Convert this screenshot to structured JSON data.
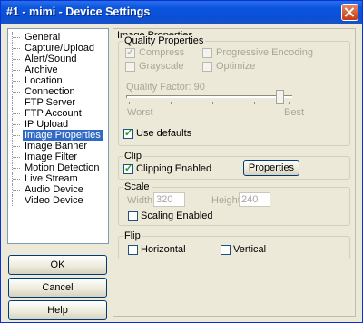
{
  "window": {
    "title": "#1 - mimi - Device Settings"
  },
  "tree": {
    "items": [
      "General",
      "Capture/Upload",
      "Alert/Sound",
      "Archive",
      "Location",
      "Connection",
      "FTP Server",
      "FTP Account",
      "IP Upload",
      "Image Properties",
      "Image Banner",
      "Image Filter",
      "Motion Detection",
      "Live Stream",
      "Audio Device",
      "Video Device"
    ],
    "selected": "Image Properties"
  },
  "buttons": {
    "ok": "OK",
    "cancel": "Cancel",
    "help": "Help"
  },
  "panel": {
    "heading": "Image Properties",
    "quality": {
      "legend": "Quality Properties",
      "compress": "Compress",
      "progressive": "Progressive Encoding",
      "grayscale": "Grayscale",
      "optimize": "Optimize",
      "factor_label": "Quality Factor: 90",
      "factor_value": 90,
      "worst": "Worst",
      "best": "Best",
      "use_defaults": "Use defaults"
    },
    "clip": {
      "legend": "Clip",
      "enabled_label": "Clipping Enabled",
      "properties_button": "Properties"
    },
    "scale": {
      "legend": "Scale",
      "width_label": "Width",
      "width_value": "320",
      "height_label": "Height",
      "height_value": "240",
      "enabled_label": "Scaling Enabled"
    },
    "flip": {
      "legend": "Flip",
      "horizontal": "Horizontal",
      "vertical": "Vertical"
    }
  }
}
